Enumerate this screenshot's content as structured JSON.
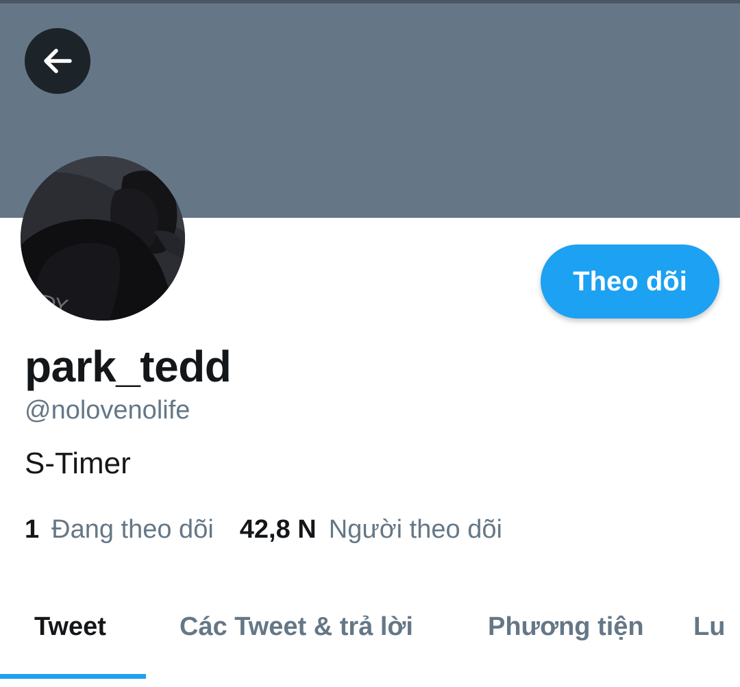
{
  "colors": {
    "banner": "#657786",
    "accent": "#1da1f2",
    "primary_text": "#14171a",
    "secondary_text": "#657786",
    "back_button_bg": "#1c2329"
  },
  "header": {
    "back_icon": "arrow-left-icon"
  },
  "profile": {
    "avatar_icon": "profile-photo",
    "display_name": "park_tedd",
    "handle": "@nolovenolife",
    "bio": "S-Timer",
    "follow_button_label": "Theo dõi"
  },
  "stats": {
    "following_count": "1",
    "following_label": "Đang theo dõi",
    "followers_count": "42,8 N",
    "followers_label": "Người theo dõi"
  },
  "tabs": [
    {
      "label": "Tweet",
      "active": true
    },
    {
      "label": "Các Tweet & trả lời",
      "active": false
    },
    {
      "label": "Phương tiện",
      "active": false
    },
    {
      "label": "Lu",
      "active": false
    }
  ]
}
